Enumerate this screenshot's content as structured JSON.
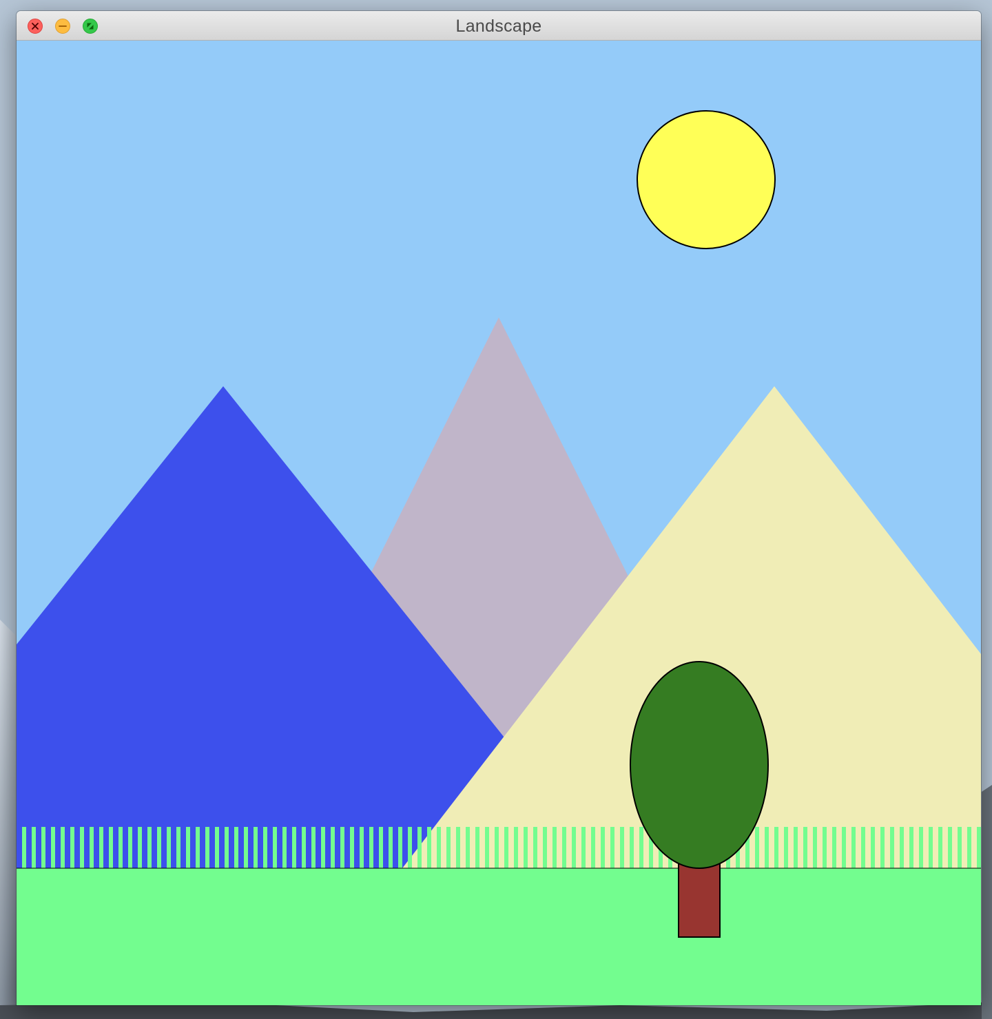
{
  "window": {
    "title": "Landscape"
  },
  "titlebar_buttons": [
    {
      "name": "close",
      "icon": "close-icon",
      "color": "#fc605c"
    },
    {
      "name": "minimize",
      "icon": "minimize-icon",
      "color": "#fdbc40"
    },
    {
      "name": "zoom",
      "icon": "zoom-icon",
      "color": "#34c84a"
    }
  ],
  "scene": {
    "sky_color": "#94cbf9",
    "sun_color": "#ffff57",
    "mountain_left_color": "#3d50ec",
    "mountain_middle_color": "#c0b5c9",
    "mountain_right_color": "#f0edb6",
    "grass_color": "#73fd8f",
    "fence_stripe_color": "#73fd8f",
    "tree_foliage_color": "#357c22",
    "tree_trunk_color": "#983530"
  }
}
